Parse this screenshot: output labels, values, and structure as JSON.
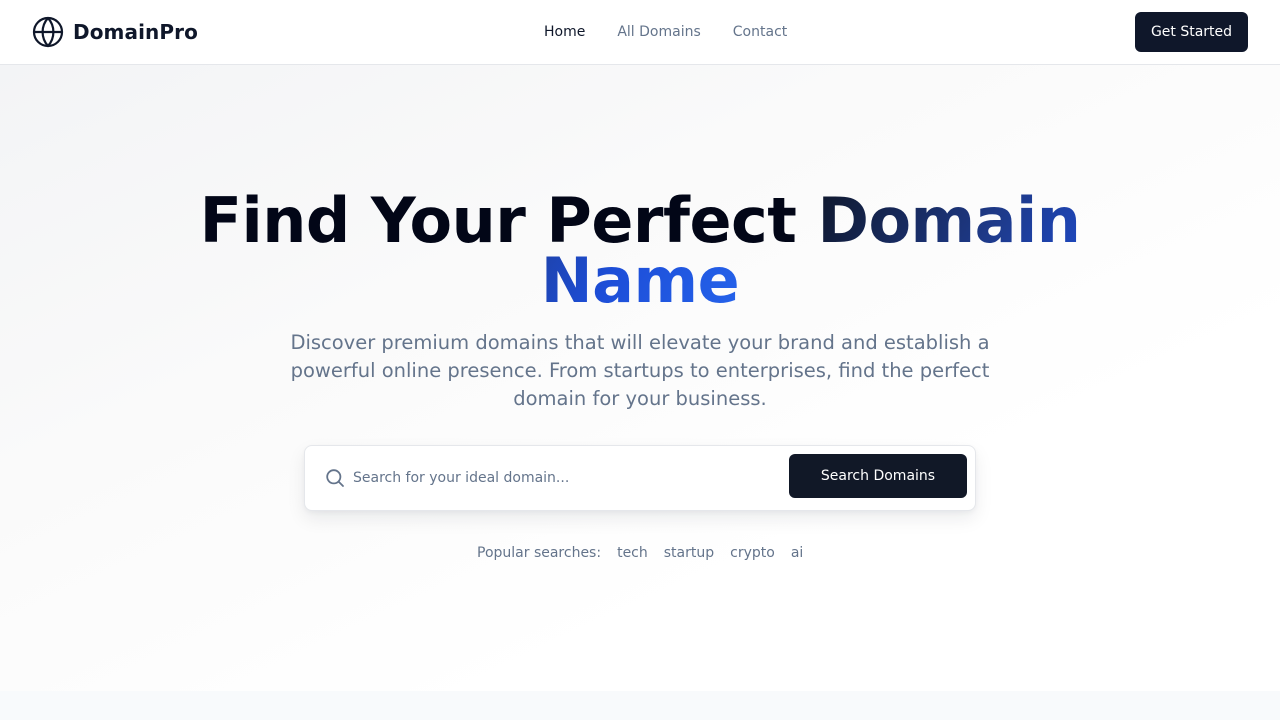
{
  "brand": {
    "name": "DomainPro",
    "icon": "globe-icon"
  },
  "nav": {
    "links": [
      {
        "label": "Home",
        "active": true
      },
      {
        "label": "All Domains",
        "active": false
      },
      {
        "label": "Contact",
        "active": false
      }
    ],
    "cta_label": "Get Started"
  },
  "hero": {
    "title_part1": "Find Your Perfect ",
    "title_part2": "Domain Name",
    "subtitle": "Discover premium domains that will elevate your brand and establish a powerful online presence. From startups to enterprises, find the perfect domain for your business.",
    "search": {
      "icon": "search-icon",
      "placeholder": "Search for your ideal domain...",
      "value": "",
      "button_label": "Search Domains"
    },
    "popular": {
      "label": "Popular searches:",
      "tags": [
        "tech",
        "startup",
        "crypto",
        "ai"
      ]
    }
  },
  "colors": {
    "primary": "#0f172a",
    "accent_start": "#1e3a8a",
    "accent_end": "#2563eb",
    "muted_text": "#64748b",
    "border": "#e5e7eb"
  }
}
